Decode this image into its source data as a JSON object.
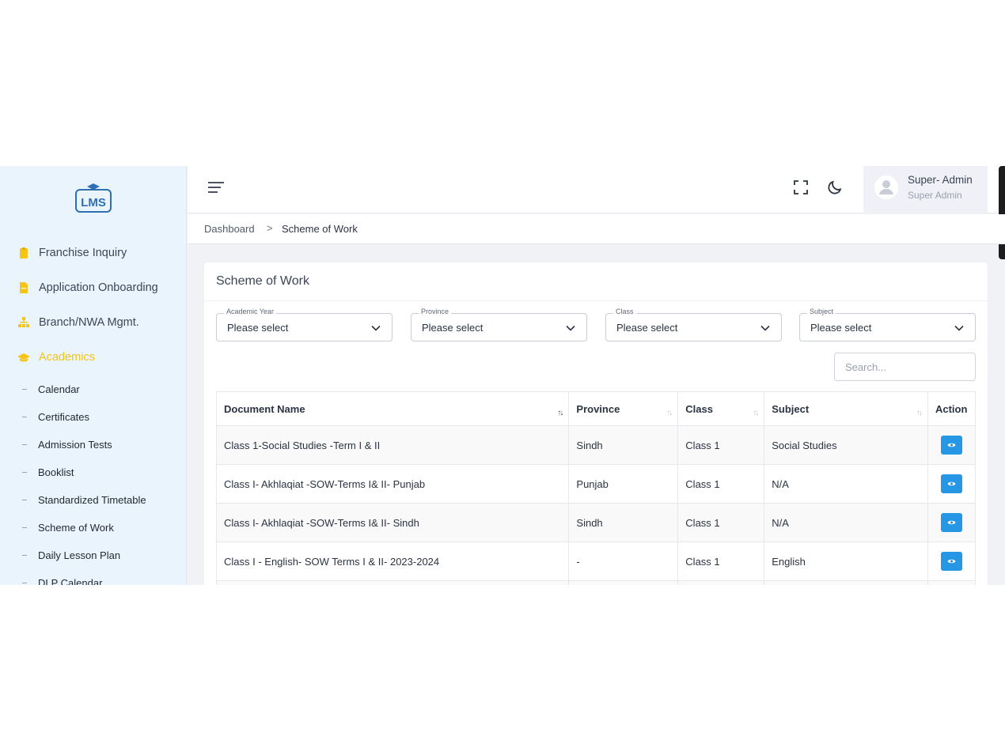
{
  "sidebar": {
    "logo_text": "LMS",
    "items": [
      {
        "label": "Franchise Inquiry"
      },
      {
        "label": "Application Onboarding"
      },
      {
        "label": "Branch/NWA Mgmt."
      },
      {
        "label": "Academics"
      }
    ],
    "sub_items": [
      {
        "label": "Calendar"
      },
      {
        "label": "Certificates"
      },
      {
        "label": "Admission Tests"
      },
      {
        "label": "Booklist"
      },
      {
        "label": "Standardized Timetable"
      },
      {
        "label": "Scheme of Work"
      },
      {
        "label": "Daily Lesson Plan"
      },
      {
        "label": "DLP Calendar"
      }
    ]
  },
  "header": {
    "user_name": "Super- Admin",
    "user_role": "Super Admin"
  },
  "breadcrumb": {
    "home": "Dashboard",
    "separator": ">",
    "current": "Scheme of Work"
  },
  "card": {
    "title": "Scheme of Work",
    "filters": [
      {
        "label": "Academic Year",
        "value": "Please select"
      },
      {
        "label": "Province",
        "value": "Please select"
      },
      {
        "label": "Class",
        "value": "Please select"
      },
      {
        "label": "Subject",
        "value": "Please select"
      }
    ],
    "search_placeholder": "Search..."
  },
  "table": {
    "columns": [
      "Document Name",
      "Province",
      "Class",
      "Subject",
      "Action"
    ],
    "rows": [
      {
        "document": "Class 1-Social Studies -Term I & II",
        "province": "Sindh",
        "class": "Class 1",
        "subject": "Social Studies"
      },
      {
        "document": "Class I- Akhlaqiat -SOW-Terms I& II- Punjab",
        "province": "Punjab",
        "class": "Class 1",
        "subject": "N/A"
      },
      {
        "document": "Class I- Akhlaqiat -SOW-Terms I& II- Sindh",
        "province": "Sindh",
        "class": "Class 1",
        "subject": "N/A"
      },
      {
        "document": "Class I - English- SOW Terms I & II- 2023-2024",
        "province": "-",
        "class": "Class 1",
        "subject": "English"
      }
    ]
  },
  "colors": {
    "sidebar_bg": "#eaf4fd",
    "active_accent": "#f5c417",
    "action_button": "#2597e4"
  }
}
